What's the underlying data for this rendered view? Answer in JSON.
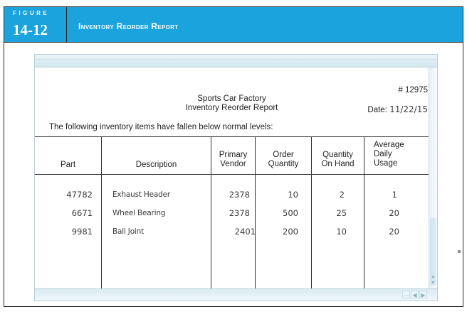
{
  "figure": {
    "word": "FIGURE",
    "number": "14-12",
    "title": "Inventory Reorder Report"
  },
  "report": {
    "company": "Sports Car Factory",
    "report_name": "Inventory Reorder Report",
    "number": "# 12975",
    "date_label": "Date:",
    "date_value": "11/22/15",
    "intro": "The following inventory items have fallen below normal levels:",
    "columns": {
      "part": "Part",
      "description": "Description",
      "vendor_l1": "Primary",
      "vendor_l2": "Vendor",
      "order_l1": "Order",
      "order_l2": "Quantity",
      "onhand_l1": "Quantity",
      "onhand_l2": "On Hand",
      "usage_l1": "Average",
      "usage_l2": "Daily",
      "usage_l3": "Usage"
    },
    "rows": [
      {
        "part": "47782",
        "description": "Exhaust Header",
        "vendor": "2378",
        "order_qty": "10",
        "on_hand": "2",
        "daily_usage": "1"
      },
      {
        "part": "6671",
        "description": "Wheel Bearing",
        "vendor": "2378",
        "order_qty": "500",
        "on_hand": "25",
        "daily_usage": "20"
      },
      {
        "part": "9981",
        "description": "Ball Joint",
        "vendor": "2401",
        "order_qty": "200",
        "on_hand": "10",
        "daily_usage": "20"
      }
    ]
  },
  "scroll_icons": {
    "up": "arrow-up-icon",
    "down": "arrow-down-icon",
    "left": "arrow-left-icon",
    "right": "arrow-right-icon"
  },
  "colors": {
    "header_blue": "#1aa3dc"
  }
}
